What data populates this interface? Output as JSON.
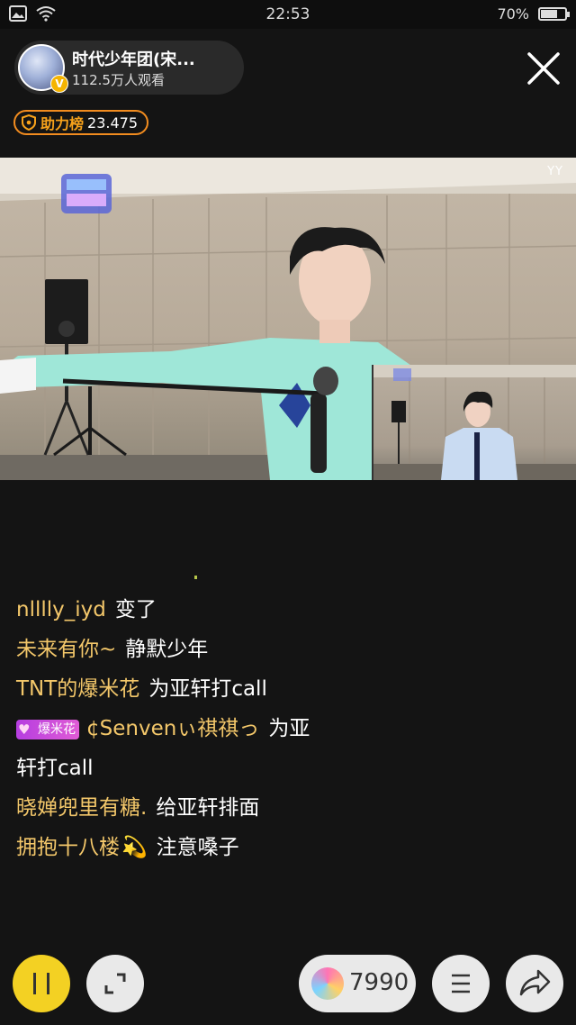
{
  "status_bar": {
    "time": "22:53",
    "battery": "70%",
    "battery_level": 0.7
  },
  "host": {
    "name": "时代少年团(宋...",
    "viewers": "112.5万人观看",
    "verified_badge": "V"
  },
  "rank": {
    "label": "助力榜",
    "value": "23.475"
  },
  "video": {
    "watermark": "YY"
  },
  "comments": [
    {
      "user": "nlllly_iyd",
      "text": "变了"
    },
    {
      "user": "未来有你~",
      "text": "静默少年"
    },
    {
      "user": "TNT的爆米花",
      "text": "为亚轩打call"
    },
    {
      "badge": "爆米花",
      "user": "¢Senvenぃ祺祺っ",
      "text": "为亚",
      "text_cont": "轩打call"
    },
    {
      "user": "晓婵兜里有糖.",
      "text": "给亚轩排面"
    },
    {
      "user": "拥抱十八楼",
      "emoji": "💫",
      "text": "注意嗓子"
    }
  ],
  "bottom_bar": {
    "gift_count": "7990"
  },
  "colors": {
    "accent_yellow": "#f3d123",
    "username": "#f3c76a",
    "rank_orange": "#f28c1f"
  },
  "icons": [
    "wifi-icon",
    "close-icon",
    "shield-icon",
    "pause-icon",
    "expand-icon",
    "gift-icon",
    "list-icon",
    "share-icon"
  ]
}
